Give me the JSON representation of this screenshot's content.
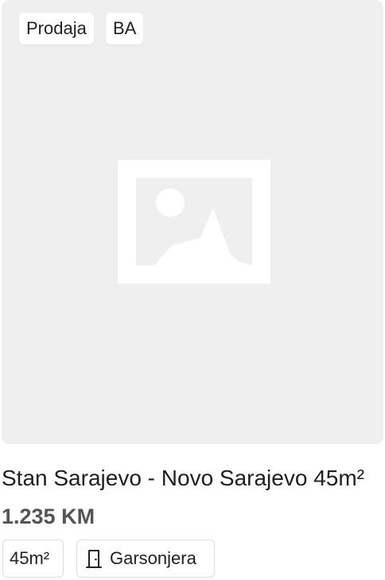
{
  "listing": {
    "badges": {
      "type": "Prodaja",
      "country": "BA"
    },
    "image": {
      "icon": "image-placeholder-icon"
    },
    "title": "Stan Sarajevo - Novo Sarajevo 45m²",
    "price": "1.235 KM",
    "features": {
      "area": "45m²",
      "rooms_icon": "door-icon",
      "rooms": "Garsonjera"
    }
  },
  "colors": {
    "image_background": "#f0eff0",
    "price": "#555555",
    "chip_border": "#dddddd"
  }
}
